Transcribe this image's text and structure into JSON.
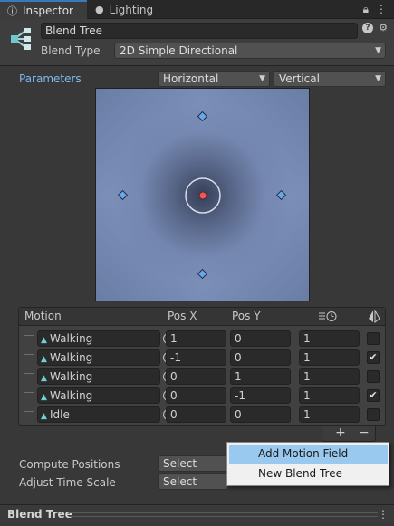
{
  "tabs": [
    {
      "label": "Inspector",
      "icon": "info-icon"
    },
    {
      "label": "Lighting",
      "icon": "bulb-icon"
    }
  ],
  "header": {
    "name": "Blend Tree",
    "blend_type_label": "Blend Type",
    "blend_type_value": "2D Simple Directional"
  },
  "parameters": {
    "label": "Parameters",
    "x_param": "Horizontal",
    "y_param": "Vertical"
  },
  "table": {
    "headers": {
      "motion": "Motion",
      "pos_x": "Pos X",
      "pos_y": "Pos Y"
    },
    "rows": [
      {
        "motion": "Walking",
        "pos_x": "1",
        "pos_y": "0",
        "speed": "1",
        "mirror": false
      },
      {
        "motion": "Walking",
        "pos_x": "-1",
        "pos_y": "0",
        "speed": "1",
        "mirror": true
      },
      {
        "motion": "Walking",
        "pos_x": "0",
        "pos_y": "1",
        "speed": "1",
        "mirror": false
      },
      {
        "motion": "Walking",
        "pos_x": "0",
        "pos_y": "-1",
        "speed": "1",
        "mirror": true
      },
      {
        "motion": "Idle",
        "pos_x": "0",
        "pos_y": "0",
        "speed": "1",
        "mirror": false
      }
    ]
  },
  "buttons": {
    "add": "+",
    "remove": "−"
  },
  "options": {
    "compute_positions_label": "Compute Positions",
    "compute_positions_value": "Select",
    "adjust_time_label": "Adjust Time Scale",
    "adjust_time_value": "Select"
  },
  "popup_menu": [
    "Add Motion Field",
    "New Blend Tree"
  ],
  "footer": {
    "title": "Blend Tree"
  },
  "colors": {
    "accent": "#3a79bb",
    "parameters_link": "#7eb8ee",
    "menu_highlight": "#99c9ef"
  }
}
